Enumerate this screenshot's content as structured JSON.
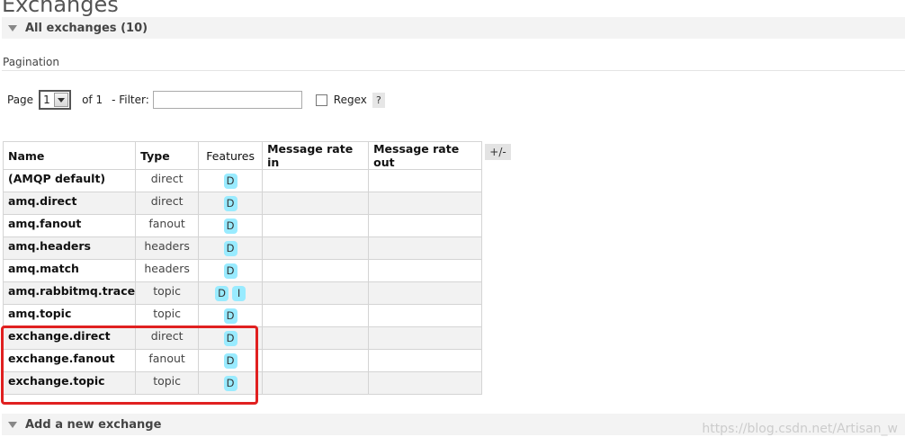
{
  "page": {
    "title": "Exchanges"
  },
  "all_exchanges": {
    "label": "All exchanges (10)"
  },
  "pagination": {
    "heading": "Pagination",
    "page_label": "Page",
    "page_value": "1",
    "of_label": "of 1",
    "filter_label": "- Filter:",
    "filter_value": "",
    "regex_label": "Regex",
    "help_label": "?"
  },
  "table": {
    "headers": {
      "name": "Name",
      "type": "Type",
      "features": "Features",
      "rate_in": "Message rate in",
      "rate_out": "Message rate out"
    },
    "toggle_columns": "+/-",
    "rows": [
      {
        "name": "(AMQP default)",
        "type": "direct",
        "features": [
          "D"
        ]
      },
      {
        "name": "amq.direct",
        "type": "direct",
        "features": [
          "D"
        ]
      },
      {
        "name": "amq.fanout",
        "type": "fanout",
        "features": [
          "D"
        ]
      },
      {
        "name": "amq.headers",
        "type": "headers",
        "features": [
          "D"
        ]
      },
      {
        "name": "amq.match",
        "type": "headers",
        "features": [
          "D"
        ]
      },
      {
        "name": "amq.rabbitmq.trace",
        "type": "topic",
        "features": [
          "D",
          "I"
        ]
      },
      {
        "name": "amq.topic",
        "type": "topic",
        "features": [
          "D"
        ]
      },
      {
        "name": "exchange.direct",
        "type": "direct",
        "features": [
          "D"
        ]
      },
      {
        "name": "exchange.fanout",
        "type": "fanout",
        "features": [
          "D"
        ]
      },
      {
        "name": "exchange.topic",
        "type": "topic",
        "features": [
          "D"
        ]
      }
    ]
  },
  "add_exchange": {
    "label": "Add a new exchange"
  },
  "watermark": "https://blog.csdn.net/Artisan_w",
  "colors": {
    "badge": "#99ebff",
    "highlight": "#e02020",
    "section_bg": "#f3f3f3"
  }
}
